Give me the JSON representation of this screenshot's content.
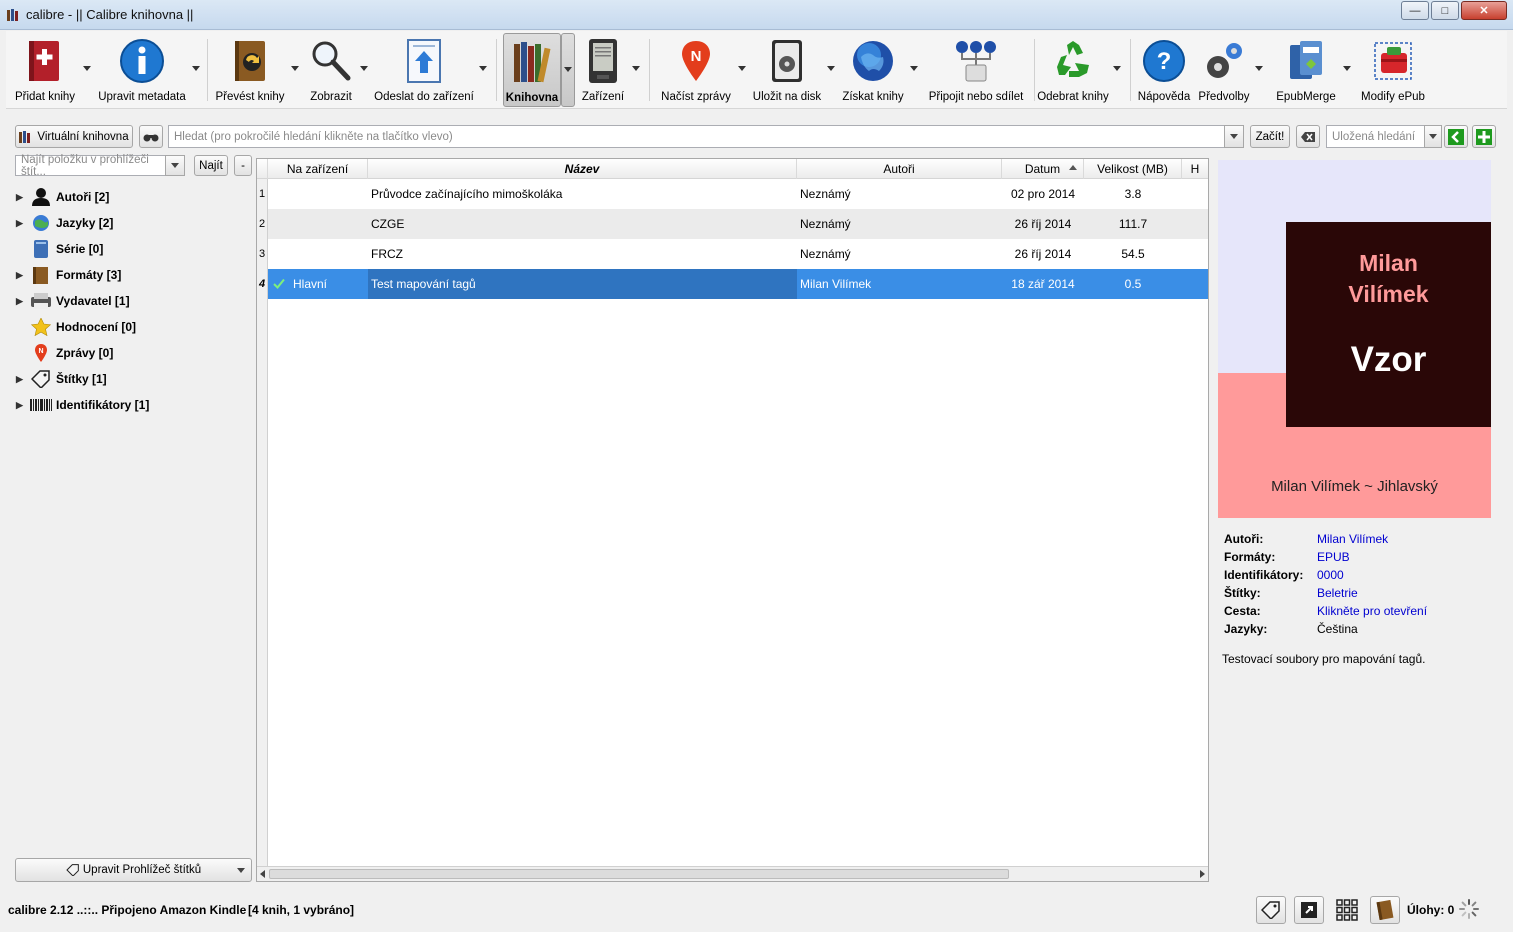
{
  "window": {
    "title": "calibre - || Calibre knihovna ||"
  },
  "toolbar": {
    "items": [
      {
        "label": "Přidat knihy",
        "icon": "add-book-icon"
      },
      {
        "label": "Upravit metadata",
        "icon": "info-icon"
      },
      {
        "label": "Převést knihy",
        "icon": "convert-icon"
      },
      {
        "label": "Zobrazit",
        "icon": "magnifier-icon"
      },
      {
        "label": "Odeslat do zařízení",
        "icon": "send-to-device-icon"
      },
      {
        "label": "Knihovna",
        "icon": "library-icon"
      },
      {
        "label": "Zařízení",
        "icon": "reader-device-icon"
      },
      {
        "label": "Načíst zprávy",
        "icon": "news-icon"
      },
      {
        "label": "Uložit na disk",
        "icon": "save-disk-icon"
      },
      {
        "label": "Získat knihy",
        "icon": "globe-icon"
      },
      {
        "label": "Připojit nebo sdílet",
        "icon": "connect-share-icon"
      },
      {
        "label": "Odebrat knihy",
        "icon": "recycle-icon"
      },
      {
        "label": "Nápověda",
        "icon": "help-icon"
      },
      {
        "label": "Předvolby",
        "icon": "preferences-icon"
      },
      {
        "label": "EpubMerge",
        "icon": "epubmerge-icon"
      },
      {
        "label": "Modify ePub",
        "icon": "modify-epub-icon"
      }
    ]
  },
  "search": {
    "virtual_library_label": "Virtuální knihovna",
    "placeholder": "Hledat (pro pokročilé hledání klikněte na tlačítko vlevo)",
    "start_label": "Začít!",
    "saved_search_placeholder": "Uložená hledání"
  },
  "tag_browser": {
    "find_placeholder": "Najít položku v prohlížeči štít...",
    "find_label": "Najít",
    "collapse_label": "-",
    "items": [
      {
        "label": "Autoři [2]",
        "expandable": true,
        "icon": "person-icon"
      },
      {
        "label": "Jazyky [2]",
        "expandable": true,
        "icon": "languages-icon"
      },
      {
        "label": "Série [0]",
        "expandable": false,
        "icon": "series-icon"
      },
      {
        "label": "Formáty [3]",
        "expandable": true,
        "icon": "formats-icon"
      },
      {
        "label": "Vydavatel [1]",
        "expandable": true,
        "icon": "publisher-icon"
      },
      {
        "label": "Hodnocení [0]",
        "expandable": false,
        "icon": "star-icon"
      },
      {
        "label": "Zprávy [0]",
        "expandable": false,
        "icon": "news-pin-icon"
      },
      {
        "label": "Štítky [1]",
        "expandable": true,
        "icon": "tag-icon"
      },
      {
        "label": "Identifikátory [1]",
        "expandable": true,
        "icon": "barcode-icon"
      }
    ],
    "manage_label": "Upravit Prohlížeč štítků"
  },
  "table": {
    "headers": [
      "Na zařízení",
      "Název",
      "Autoři",
      "Datum",
      "Velikost (MB)",
      "H"
    ],
    "rows": [
      {
        "num": "1",
        "device": "",
        "title": "Průvodce začínajícího mimoškoláka",
        "author": "Neznámý",
        "date": "02 pro 2014",
        "size": "3.8"
      },
      {
        "num": "2",
        "device": "",
        "title": "CZGE",
        "author": "Neznámý",
        "date": "26 říj 2014",
        "size": "111.7"
      },
      {
        "num": "3",
        "device": "",
        "title": "FRCZ",
        "author": "Neznámý",
        "date": "26 říj 2014",
        "size": "54.5"
      },
      {
        "num": "4",
        "device": "Hlavní",
        "title": "Test mapování tagů",
        "author": "Milan Vilímek",
        "date": "18 zář 2014",
        "size": "0.5"
      }
    ],
    "selected_row": 4
  },
  "cover": {
    "author_line1": "Milan",
    "author_line2": "Vilímek",
    "title": "Vzor",
    "byline": "Milan Vilímek ~ Jihlavský",
    "colors": {
      "background": "#e6e6fa",
      "lower": "#ff9a9a",
      "box": "#2a0707",
      "name": "#ff9a9a"
    }
  },
  "details": {
    "rows": [
      {
        "key": "Autoři:",
        "value": "Milan Vilímek",
        "link": true
      },
      {
        "key": "Formáty:",
        "value": "EPUB",
        "link": true
      },
      {
        "key": "Identifikátory:",
        "value": "0000",
        "link": true
      },
      {
        "key": "Štítky:",
        "value": "Beletrie",
        "link": true
      },
      {
        "key": "Cesta:",
        "value": "Klikněte pro otevření",
        "link": true
      },
      {
        "key": "Jazyky:",
        "value": "Čeština",
        "link": false
      }
    ],
    "comment": "Testovací soubory pro mapování tagů."
  },
  "status": {
    "left": "calibre 2.12 ..::.. Připojeno Amazon Kindle",
    "count": "[4 knih, 1 vybráno]",
    "jobs": "Úlohy: 0"
  }
}
